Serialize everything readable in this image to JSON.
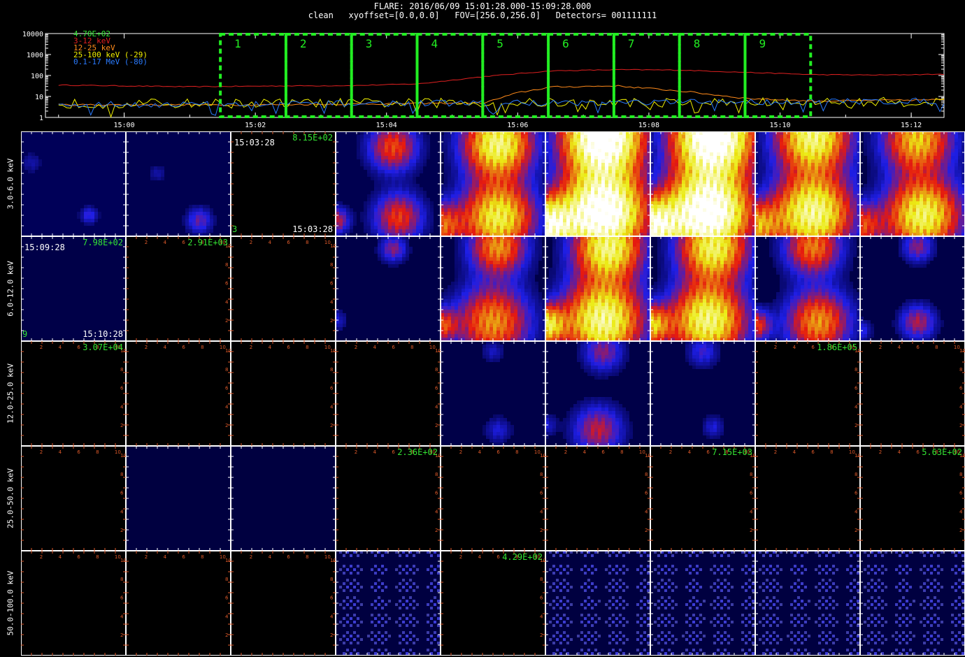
{
  "header": {
    "title": "FLARE: 2016/06/09 15:01:28.000-15:09:28.000",
    "subtitle": "clean   xyoffset=[0.0,0.0]   FOV=[256.0,256.0]   Detectors= 001111111"
  },
  "colors": {
    "frame": "#ffffff",
    "ticks": "#e05a2a",
    "label_green": "#33e533",
    "box": "#22ee22",
    "c312": "#e02020",
    "c1225": "#ff8a1a",
    "c25100": "#f0f000",
    "cmev": "#2a7bff"
  },
  "chart_data": [
    {
      "type": "line",
      "legend": [
        "4.70E+02",
        "3-12 keV",
        "12-25 keV",
        "25-100 keV (-29)",
        "0.1-17 MeV (-80)"
      ],
      "x_ticks": [
        "15:00",
        "15:02",
        "15:04",
        "15:06",
        "15:08",
        "15:10",
        "15:12"
      ],
      "y_ticks": [
        "10000",
        "1000",
        "100",
        "10",
        "1"
      ],
      "y_scale": "log",
      "ylim": [
        1,
        10000
      ],
      "xlim_minutes": [
        14.98,
        15.22
      ],
      "interval_labels": [
        "1",
        "2",
        "3",
        "4",
        "5",
        "6",
        "7",
        "8",
        "9"
      ],
      "series": [
        {
          "name": "3-12 keV",
          "color_key": "c312",
          "noise": 0.04,
          "x": [
            "14:59:00",
            "15:01:00",
            "15:02:30",
            "15:03:30",
            "15:04:30",
            "15:05:30",
            "15:06:30",
            "15:07:30",
            "15:08:30",
            "15:09:30",
            "15:10:30",
            "15:11:30",
            "15:12:30"
          ],
          "y": [
            35,
            29,
            32,
            33,
            40,
            90,
            165,
            190,
            180,
            140,
            110,
            105,
            115
          ]
        },
        {
          "name": "12-25 keV",
          "color_key": "c1225",
          "noise": 0.08,
          "x": [
            "14:59:00",
            "15:02:00",
            "15:04:00",
            "15:05:30",
            "15:06:00",
            "15:06:30",
            "15:07:30",
            "15:08:30",
            "15:09:30",
            "15:10:30",
            "15:12:30"
          ],
          "y": [
            4,
            4,
            4.5,
            5,
            15,
            28,
            32,
            18,
            8,
            6,
            7
          ]
        },
        {
          "name": "25-100 keV (-29)",
          "color_key": "c25100",
          "noise": 0.45,
          "x": [
            "14:59:00",
            "15:12:30"
          ],
          "y": [
            4.5,
            5.5
          ]
        },
        {
          "name": "0.1-17 MeV (-80)",
          "color_key": "cmev",
          "noise": 0.3,
          "x": [
            "14:59:00",
            "15:12:30"
          ],
          "y": [
            4,
            6
          ]
        }
      ],
      "intervals": [
        "15:01:28",
        "15:02:28",
        "15:03:28",
        "15:04:28",
        "15:05:28",
        "15:06:28",
        "15:07:28",
        "15:08:28",
        "15:09:28",
        "15:10:28"
      ]
    },
    {
      "type": "heatmap",
      "energy_bands": [
        "3.0-6.0 keV",
        "6.0-12.0 keV",
        "12.0-25.0 keV",
        "25.0-50.0 keV",
        "50.0-100.0 keV"
      ],
      "axis_ticks": [
        "2",
        "4",
        "6",
        "8",
        "10"
      ],
      "cells": [
        [
          {
            "bg": "#000058",
            "blobs": [
              [
                0.65,
                0.8,
                0.08,
                0.4
              ],
              [
                0.1,
                0.3,
                0.1,
                0.2
              ]
            ],
            "ring": 1
          },
          {
            "bg": "#000050",
            "blobs": [
              [
                0.7,
                0.85,
                0.12,
                0.5
              ],
              [
                0.3,
                0.4,
                0.08,
                0.2
              ]
            ],
            "ring": 1
          },
          {
            "bg": "#000000",
            "blobs": [],
            "ring": 0,
            "maxval": "8.15E+02",
            "time_tl": "15:03:28",
            "time_br": "15:03:28",
            "idx": "3"
          },
          {
            "bg": "#000050",
            "blobs": [
              [
                0.55,
                0.15,
                0.22,
                1.0
              ],
              [
                0.6,
                0.82,
                0.22,
                0.95
              ],
              [
                0.0,
                0.85,
                0.12,
                0.8
              ]
            ],
            "ring": 1
          },
          {
            "bg": "#000048",
            "blobs": [
              [
                0.55,
                0.12,
                0.3,
                2.0
              ],
              [
                0.55,
                0.82,
                0.32,
                1.8
              ],
              [
                0.0,
                0.9,
                0.2,
                1.1
              ]
            ],
            "ring": 1
          },
          {
            "bg": "#000048",
            "blobs": [
              [
                0.55,
                0.05,
                0.35,
                3.0
              ],
              [
                0.55,
                0.78,
                0.38,
                2.9
              ],
              [
                0.0,
                0.9,
                0.25,
                2.2
              ]
            ],
            "ring": 1
          },
          {
            "bg": "#000048",
            "blobs": [
              [
                0.6,
                0.05,
                0.35,
                3.0
              ],
              [
                0.55,
                0.78,
                0.38,
                2.9
              ],
              [
                0.0,
                0.9,
                0.25,
                2.2
              ]
            ],
            "ring": 1
          },
          {
            "bg": "#000048",
            "blobs": [
              [
                0.55,
                0.05,
                0.32,
                2.0
              ],
              [
                0.55,
                0.78,
                0.35,
                2.1
              ],
              [
                0.0,
                0.9,
                0.22,
                1.3
              ]
            ],
            "ring": 1
          },
          {
            "bg": "#000048",
            "blobs": [
              [
                0.55,
                0.08,
                0.3,
                1.5
              ],
              [
                0.6,
                0.8,
                0.33,
                1.9
              ],
              [
                0.0,
                0.9,
                0.2,
                1.0
              ]
            ],
            "ring": 1
          }
        ],
        [
          {
            "bg": "#000048",
            "blobs": [],
            "ring": 0,
            "maxval": "7.98E+02",
            "time_tl": "15:09:28",
            "time_br": "15:10:28",
            "idx": "9"
          },
          {
            "bg": "#000000",
            "blobs": [],
            "ring": 0,
            "maxval": "2.91E+03"
          },
          {
            "bg": "#000000",
            "blobs": [],
            "ring": 0
          },
          {
            "bg": "#000048",
            "blobs": [
              [
                0.55,
                0.12,
                0.12,
                0.6
              ],
              [
                0.0,
                0.8,
                0.1,
                0.3
              ]
            ],
            "ring": 1
          },
          {
            "bg": "#000048",
            "blobs": [
              [
                0.55,
                0.1,
                0.25,
                1.3
              ],
              [
                0.5,
                0.82,
                0.32,
                1.3
              ],
              [
                0.0,
                0.85,
                0.15,
                1.0
              ]
            ],
            "ring": 1
          },
          {
            "bg": "#000048",
            "blobs": [
              [
                0.6,
                0.1,
                0.3,
                2.0
              ],
              [
                0.55,
                0.8,
                0.35,
                2.1
              ],
              [
                0.0,
                0.85,
                0.18,
                1.7
              ]
            ],
            "ring": 1
          },
          {
            "bg": "#000048",
            "blobs": [
              [
                0.6,
                0.1,
                0.3,
                1.9
              ],
              [
                0.55,
                0.8,
                0.33,
                2.0
              ],
              [
                0.0,
                0.85,
                0.18,
                1.5
              ]
            ],
            "ring": 1
          },
          {
            "bg": "#000048",
            "blobs": [
              [
                0.55,
                0.1,
                0.25,
                1.2
              ],
              [
                0.6,
                0.82,
                0.28,
                1.3
              ],
              [
                0.0,
                0.85,
                0.14,
                1.0
              ]
            ],
            "ring": 1
          },
          {
            "bg": "#000048",
            "blobs": [
              [
                0.55,
                0.1,
                0.14,
                0.6
              ],
              [
                0.55,
                0.82,
                0.16,
                0.7
              ],
              [
                0.0,
                0.9,
                0.1,
                0.4
              ]
            ],
            "ring": 1
          }
        ],
        [
          {
            "bg": "#000000",
            "blobs": [],
            "ring": 0,
            "maxval": "3.07E+04"
          },
          {
            "bg": "#000000",
            "blobs": [],
            "ring": 0
          },
          {
            "bg": "#000000",
            "blobs": [],
            "ring": 0
          },
          {
            "bg": "#000000",
            "blobs": [],
            "ring": 0
          },
          {
            "bg": "#000048",
            "blobs": [
              [
                0.5,
                0.1,
                0.1,
                0.25
              ],
              [
                0.55,
                0.85,
                0.12,
                0.3
              ]
            ],
            "ring": 1
          },
          {
            "bg": "#000048",
            "blobs": [
              [
                0.55,
                0.1,
                0.18,
                0.6
              ],
              [
                0.5,
                0.85,
                0.22,
                0.75
              ],
              [
                0.0,
                0.8,
                0.1,
                0.3
              ]
            ],
            "ring": 1
          },
          {
            "bg": "#000048",
            "blobs": [
              [
                0.5,
                0.1,
                0.14,
                0.4
              ],
              [
                0.6,
                0.82,
                0.1,
                0.3
              ]
            ],
            "ring": 1
          },
          {
            "bg": "#000000",
            "blobs": [],
            "ring": 0,
            "maxval": "1.86E+05"
          },
          {
            "bg": "#000000",
            "blobs": [],
            "ring": 0
          }
        ],
        [
          {
            "bg": "#000000",
            "blobs": [],
            "ring": 0
          },
          {
            "bg": "#000040",
            "blobs": [],
            "ring": 0
          },
          {
            "bg": "#000040",
            "blobs": [],
            "ring": 0
          },
          {
            "bg": "#000000",
            "blobs": [],
            "ring": 0,
            "maxval": "2.36E+02"
          },
          {
            "bg": "#000000",
            "blobs": [],
            "ring": 0
          },
          {
            "bg": "#000000",
            "blobs": [],
            "ring": 0
          },
          {
            "bg": "#000000",
            "blobs": [],
            "ring": 0,
            "maxval": "7.15E+03"
          },
          {
            "bg": "#000000",
            "blobs": [],
            "ring": 0
          },
          {
            "bg": "#000000",
            "blobs": [],
            "ring": 0,
            "maxval": "5.63E+02"
          }
        ],
        [
          {
            "bg": "#000000",
            "blobs": [],
            "ring": 0
          },
          {
            "bg": "#000000",
            "blobs": [],
            "ring": 0
          },
          {
            "bg": "#000000",
            "blobs": [],
            "ring": 0
          },
          {
            "bg": "#000040",
            "blobs": [],
            "ring": 0,
            "speckle": 1
          },
          {
            "bg": "#000000",
            "blobs": [],
            "ring": 0,
            "maxval": "4.29E+02"
          },
          {
            "bg": "#000040",
            "blobs": [],
            "ring": 0,
            "speckle": 1
          },
          {
            "bg": "#000040",
            "blobs": [],
            "ring": 0,
            "speckle": 1
          },
          {
            "bg": "#000040",
            "blobs": [],
            "ring": 0,
            "speckle": 1
          },
          {
            "bg": "#000040",
            "blobs": [],
            "ring": 0,
            "speckle": 1
          }
        ]
      ]
    }
  ]
}
